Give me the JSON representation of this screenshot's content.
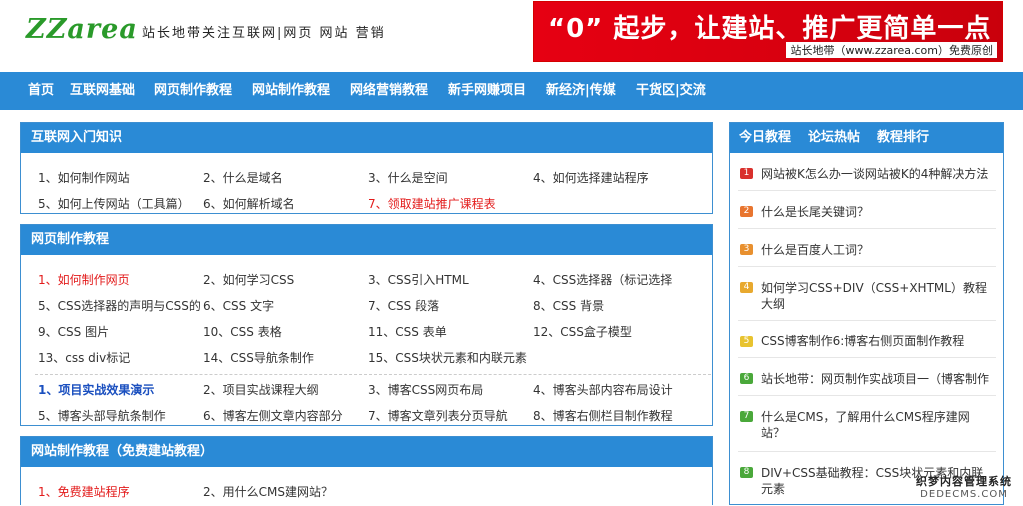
{
  "header": {
    "logo": "ZZarea",
    "slogan": "站长地带关注互联网|网页 网站 营销",
    "banner_main": "“0” 起步，让建站、推广更简单一点",
    "banner_sub": "站长地带（www.zzarea.com）免费原创"
  },
  "nav": [
    "首页",
    "互联网基础",
    "网页制作教程",
    "网站制作教程",
    "网络营销教程",
    "新手网赚项目",
    "新经济|传媒",
    "干货区|交流"
  ],
  "sections": {
    "internet": {
      "title": "互联网入门知识",
      "links": [
        "1、如何制作网站",
        "2、什么是域名",
        "3、什么是空间",
        "4、如何选择建站程序",
        "5、如何上传网站（工具篇）",
        "6、如何解析域名",
        "7、领取建站推广课程表"
      ]
    },
    "webpage": {
      "title": "网页制作教程",
      "links": [
        "1、如何制作网页",
        "2、如何学习CSS",
        "3、CSS引入HTML",
        "4、CSS选择器（标记选择",
        "5、CSS选择器的声明与CSS的",
        "6、CSS 文字",
        "7、CSS 段落",
        "8、CSS 背景",
        "9、CSS 图片",
        "10、CSS 表格",
        "11、CSS 表单",
        "12、CSS盒子模型",
        "13、css div标记",
        "14、CSS导航条制作",
        "15、CSS块状元素和内联元素"
      ],
      "project_links": [
        "1、项目实战效果演示",
        "2、项目实战课程大纲",
        "3、博客CSS网页布局",
        "4、博客头部内容布局设计",
        "5、博客头部导航条制作",
        "6、博客左侧文章内容部分",
        "7、博客文章列表分页导航",
        "8、博客右侧栏目制作教程"
      ]
    },
    "website": {
      "title": "网站制作教程（免费建站教程）",
      "links": [
        "1、免费建站程序",
        "2、用什么CMS建网站？"
      ]
    }
  },
  "sidebar": {
    "tabs": [
      "今日教程",
      "论坛热帖",
      "教程排行"
    ],
    "items": [
      {
        "num": "1",
        "text": "网站被K怎么办一谈网站被K的4种解决方法"
      },
      {
        "num": "2",
        "text": "什么是长尾关键词？"
      },
      {
        "num": "3",
        "text": "什么是百度人工词？"
      },
      {
        "num": "4",
        "text": "如何学习CSS+DIV（CSS+XHTML）教程大纲"
      },
      {
        "num": "5",
        "text": "CSS博客制作6:博客右侧页面制作教程"
      },
      {
        "num": "6",
        "text": "站长地带：网页制作实战项目一（博客制作"
      },
      {
        "num": "7",
        "text": "什么是CMS，了解用什么CMS程序建网站？"
      },
      {
        "num": "8",
        "text": "DIV+CSS基础教程：CSS块状元素和内联元素"
      }
    ],
    "num_colors": [
      "#d9302c",
      "#e8752f",
      "#e8902f",
      "#e8a92f",
      "#e8c32f",
      "#4aa83a",
      "#4aa83a",
      "#4aa83a"
    ]
  },
  "watermark": {
    "line1": "织梦内容管理系统",
    "line2": "DEDECMS.COM"
  },
  "colors": {
    "nav_blue": "#2a8ad6",
    "red_link": "#e31b1b",
    "blue_link": "#1a4fbf",
    "banner_red": "#e60012",
    "logo_green": "#2a9a2a"
  }
}
